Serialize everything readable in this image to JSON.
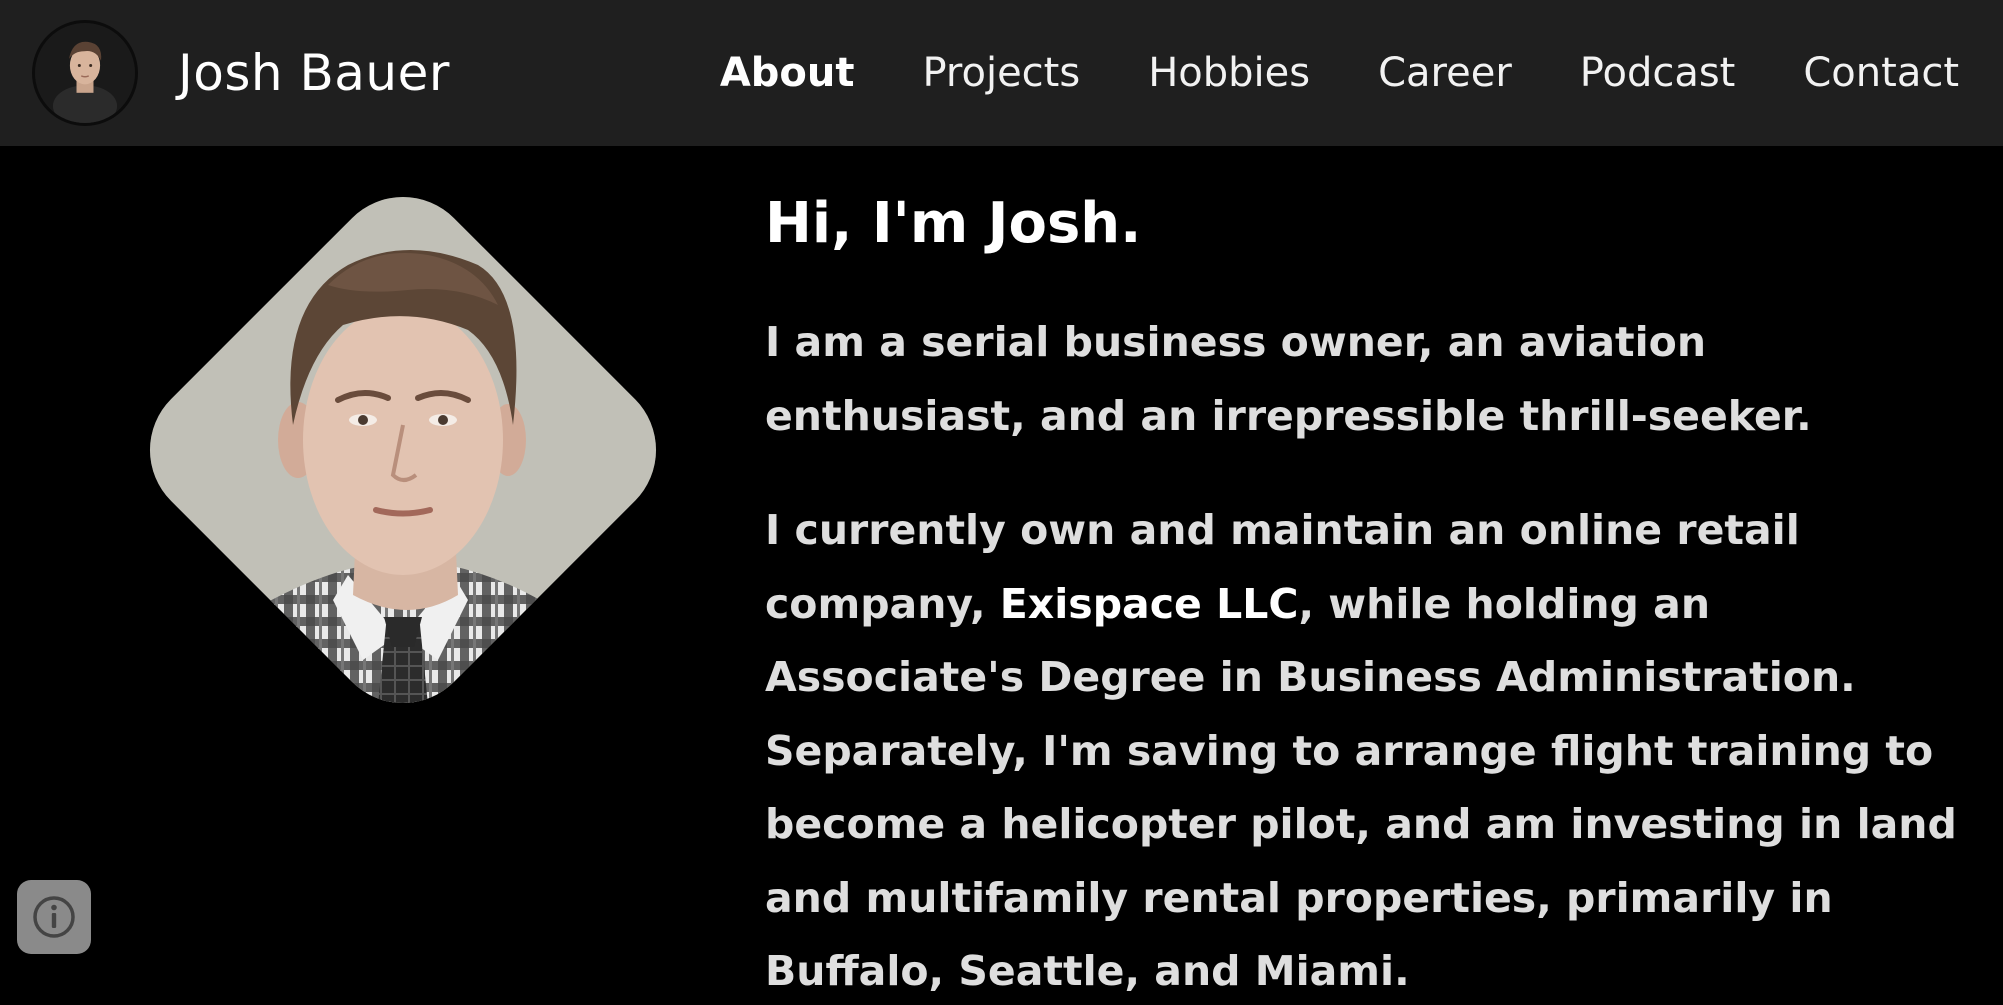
{
  "header": {
    "site_name": "Josh Bauer",
    "nav": [
      {
        "label": "About",
        "active": true
      },
      {
        "label": "Projects",
        "active": false
      },
      {
        "label": "Hobbies",
        "active": false
      },
      {
        "label": "Career",
        "active": false
      },
      {
        "label": "Podcast",
        "active": false
      },
      {
        "label": "Contact",
        "active": false
      }
    ]
  },
  "main": {
    "heading": "Hi, I'm Josh.",
    "intro": "I am a serial business owner, an aviation enthusiast, and an irrepressible thrill-seeker.",
    "bio_before": "I currently own and maintain an online retail company, ",
    "company": "Exispace LLC",
    "bio_after": ", while holding an Associate's Degree in Business Administration. Separately, I'm saving to arrange flight training to become a helicopter pilot, and am investing in land and multifamily rental properties, primarily in Buffalo, Seattle, and Miami."
  },
  "icons": {
    "info": "info-icon"
  },
  "colors": {
    "navbar_bg": "#1f1f1f",
    "page_bg": "#000000",
    "info_button_bg": "#8a8a8a"
  }
}
